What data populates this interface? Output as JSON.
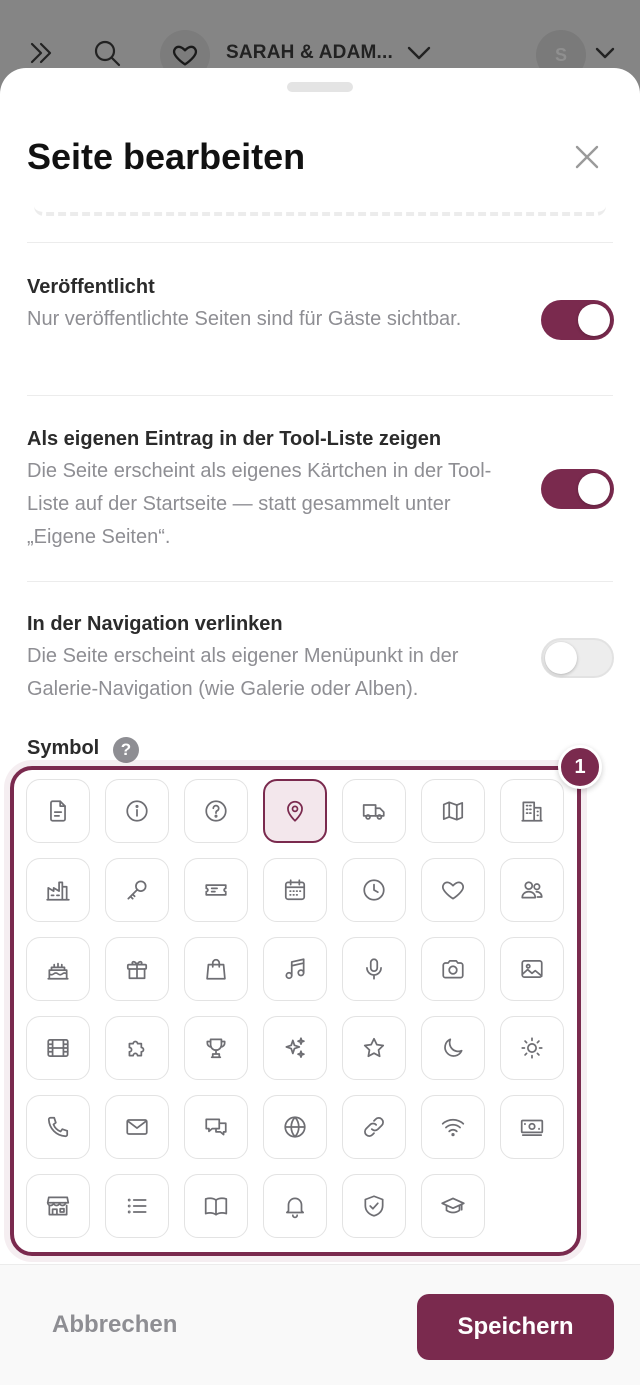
{
  "topbar": {
    "couple_name": "SARAH & ADAM...",
    "avatar_initial": "S"
  },
  "sheet": {
    "title": "Seite bearbeiten"
  },
  "settings": [
    {
      "title": "Veröffentlicht",
      "description": "Nur veröffentlichte Seiten sind für Gäste sichtbar.",
      "enabled": true
    },
    {
      "title": "Als eigenen Eintrag in der Tool-Liste zeigen",
      "description": "Die Seite erscheint als eigenes Kärtchen in der Tool-Liste auf der Startseite — statt gesammelt unter „Eigene Seiten“.",
      "enabled": true
    },
    {
      "title": "In der Navigation verlinken",
      "description": "Die Seite erscheint als eigener Menüpunkt in der Galerie-Navigation (wie Galerie oder Alben).",
      "enabled": false
    }
  ],
  "symbol": {
    "label": "Symbol",
    "help": "?",
    "badge": "1",
    "selected": "map-pin-icon",
    "icons": [
      "document-icon",
      "info-icon",
      "question-icon",
      "map-pin-icon",
      "truck-icon",
      "map-icon",
      "building-icon",
      "factory-icon",
      "key-icon",
      "ticket-icon",
      "calendar-icon",
      "clock-icon",
      "heart-icon",
      "users-icon",
      "cake-icon",
      "gift-icon",
      "shopping-bag-icon",
      "music-icon",
      "microphone-icon",
      "camera-icon",
      "image-icon",
      "film-icon",
      "puzzle-icon",
      "trophy-icon",
      "sparkles-icon",
      "star-icon",
      "moon-icon",
      "sun-icon",
      "phone-icon",
      "mail-icon",
      "chat-icon",
      "globe-icon",
      "link-icon",
      "wifi-icon",
      "money-icon",
      "store-icon",
      "list-icon",
      "book-icon",
      "bell-icon",
      "shield-check-icon",
      "graduation-cap-icon"
    ]
  },
  "footer": {
    "cancel_label": "Abbrechen",
    "save_label": "Speichern"
  },
  "colors": {
    "accent": "#7a2a4e",
    "muted_text": "#8e8e93"
  }
}
